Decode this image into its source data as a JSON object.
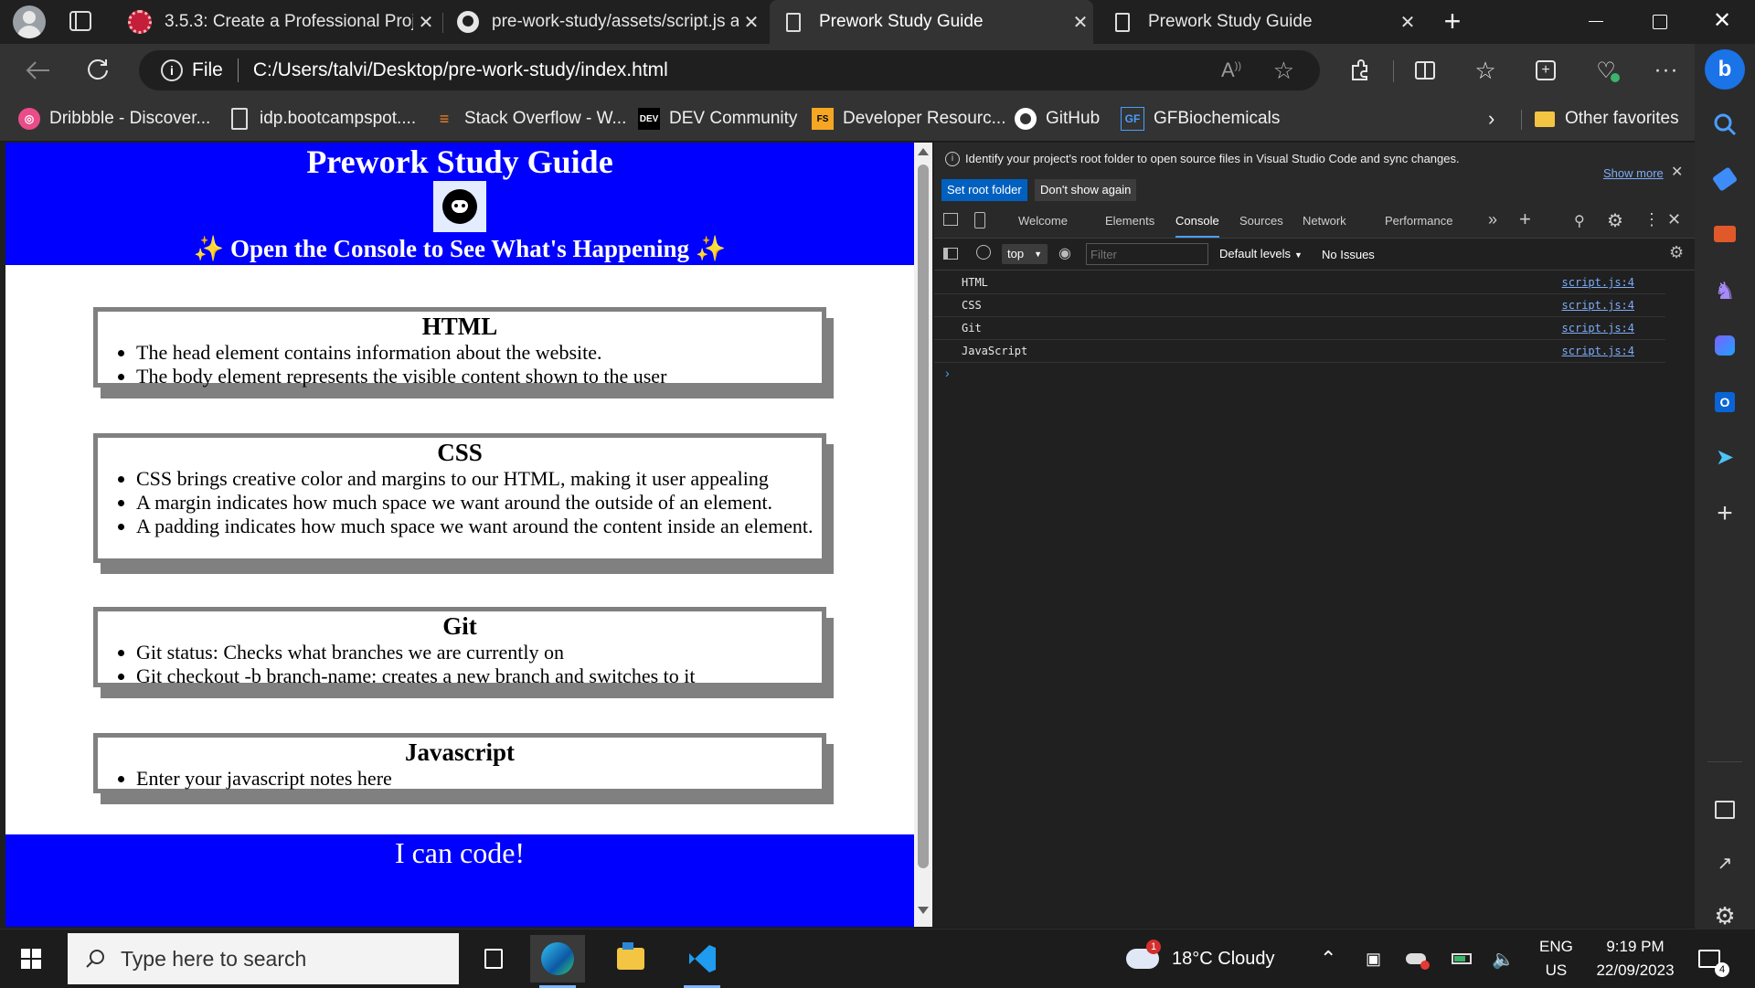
{
  "tabs": [
    {
      "label": "3.5.3: Create a Professional Proje"
    },
    {
      "label": "pre-work-study/assets/script.js at"
    },
    {
      "label": "Prework Study Guide"
    },
    {
      "label": "Prework Study Guide"
    }
  ],
  "address": {
    "scheme_label": "File",
    "url": "C:/Users/talvi/Desktop/pre-work-study/index.html",
    "read_aloud_label": "A"
  },
  "favorites": [
    {
      "label": "Dribbble - Discover..."
    },
    {
      "label": "idp.bootcampspot...."
    },
    {
      "label": "Stack Overflow - W..."
    },
    {
      "label": "DEV Community",
      "icon_text": "DEV"
    },
    {
      "label": "Developer Resourc...",
      "icon_text": "FS"
    },
    {
      "label": "GitHub"
    },
    {
      "label": "GFBiochemicals",
      "icon_text": "GF"
    }
  ],
  "other_favorites": "Other favorites",
  "page": {
    "title": "Prework Study Guide",
    "subtitle": "✨ Open the Console to See What's Happening ✨",
    "sections": [
      {
        "title": "HTML",
        "items": [
          "The head element contains information about the website.",
          "The body element represents the visible content shown to the user"
        ]
      },
      {
        "title": "CSS",
        "items": [
          "CSS brings creative color and margins to our HTML, making it user appealing",
          "A margin indicates how much space we want around the outside of an element.",
          "A padding indicates how much space we want around the content inside an element."
        ]
      },
      {
        "title": "Git",
        "items": [
          "Git status: Checks what branches we are currently on",
          "Git checkout -b branch-name: creates a new branch and switches to it"
        ]
      },
      {
        "title": "Javascript",
        "items": [
          "Enter your javascript notes here"
        ]
      }
    ],
    "footer": "I can code!"
  },
  "devtools": {
    "info_message": "Identify your project's root folder to open source files in Visual Studio Code and sync changes.",
    "show_more": "Show more",
    "set_root_button": "Set root folder",
    "dont_show_button": "Don't show again",
    "tabs": [
      "Welcome",
      "Elements",
      "Console",
      "Sources",
      "Network",
      "Performance"
    ],
    "active_tab": "Console",
    "context": "top",
    "filter_placeholder": "Filter",
    "levels": "Default levels",
    "issues": "No Issues",
    "logs": [
      {
        "message": "HTML",
        "source": "script.js:4"
      },
      {
        "message": "CSS",
        "source": "script.js:4"
      },
      {
        "message": "Git",
        "source": "script.js:4"
      },
      {
        "message": "JavaScript",
        "source": "script.js:4"
      }
    ]
  },
  "taskbar": {
    "search_placeholder": "Type here to search",
    "weather": "18°C  Cloudy",
    "weather_badge": "1",
    "lang_top": "ENG",
    "lang_bottom": "US",
    "time": "9:19 PM",
    "date": "22/09/2023",
    "notification_count": "4"
  },
  "colors": {
    "page_blue": "#0000ff",
    "section_border": "#808080",
    "devtools_bg": "#202020",
    "link_blue": "#7cacf8",
    "primary_button": "#0060c0"
  }
}
